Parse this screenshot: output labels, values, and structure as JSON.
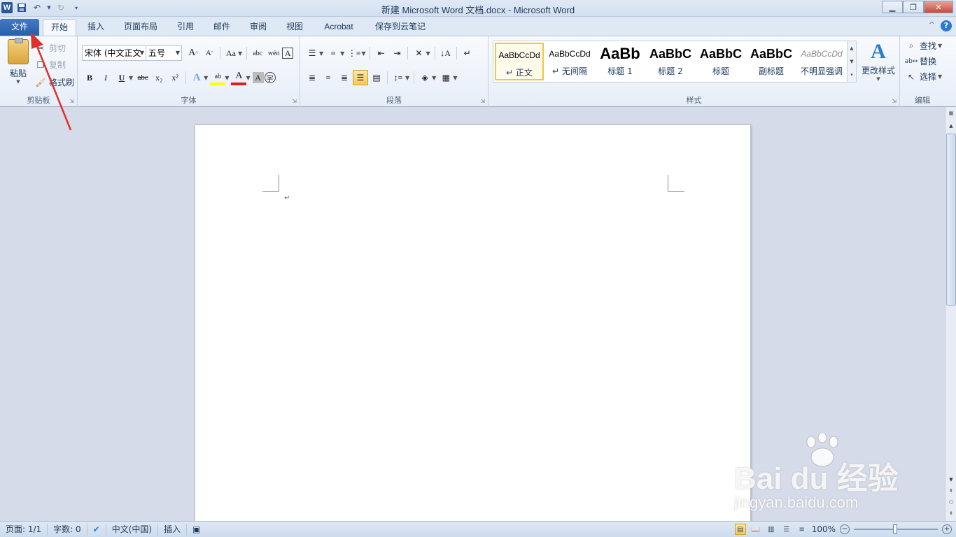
{
  "titlebar": {
    "title": "新建 Microsoft Word 文档.docx  -  Microsoft Word",
    "app_icon": "W",
    "qat_icons": [
      "save-icon",
      "undo-icon",
      "redo-icon",
      "customize-icon"
    ]
  },
  "tabs": {
    "file": "文件",
    "items": [
      "开始",
      "插入",
      "页面布局",
      "引用",
      "邮件",
      "审阅",
      "视图",
      "Acrobat",
      "保存到云笔记"
    ],
    "active": "开始",
    "help": "?",
    "minimize_ribbon": "^"
  },
  "clipboard": {
    "paste": "粘贴",
    "cut": "剪切",
    "copy": "复制",
    "format_painter": "格式刷",
    "group_label": "剪贴板"
  },
  "font": {
    "font_name": "宋体 (中文正文",
    "font_size": "五号",
    "grow": "A",
    "shrink": "A",
    "change_case": "Aa",
    "bold": "B",
    "italic": "I",
    "underline": "U",
    "strike": "abc",
    "subscript": "x₂",
    "superscript": "x²",
    "group_label": "字体"
  },
  "paragraph": {
    "group_label": "段落"
  },
  "styles": {
    "items": [
      {
        "preview": "AaBbCcDd",
        "name": "正文",
        "selected": true
      },
      {
        "preview": "AaBbCcDd",
        "name": "无间隔",
        "selected": false
      },
      {
        "preview": "AaBb",
        "name": "标题 1",
        "selected": false
      },
      {
        "preview": "AaBbC",
        "name": "标题 2",
        "selected": false
      },
      {
        "preview": "AaBbC",
        "name": "标题",
        "selected": false
      },
      {
        "preview": "AaBbC",
        "name": "副标题",
        "selected": false
      },
      {
        "preview": "AaBbCcDd",
        "name": "不明显强调",
        "selected": false
      }
    ],
    "change_styles": "更改样式",
    "group_label": "样式"
  },
  "editing": {
    "find": "查找",
    "replace": "替换",
    "select": "选择",
    "group_label": "编辑"
  },
  "document": {
    "paragraph_mark": "↵"
  },
  "statusbar": {
    "page": "页面: 1/1",
    "words": "字数: 0",
    "language": "中文(中国)",
    "mode": "插入",
    "zoom": "100%"
  },
  "watermark": {
    "logo": "Bai du 经验",
    "url": "jingyan.baidu.com"
  },
  "colors": {
    "accent": "#2b579a",
    "file_tab": "#2a5ea8",
    "annotation_arrow": "#e0302a"
  }
}
